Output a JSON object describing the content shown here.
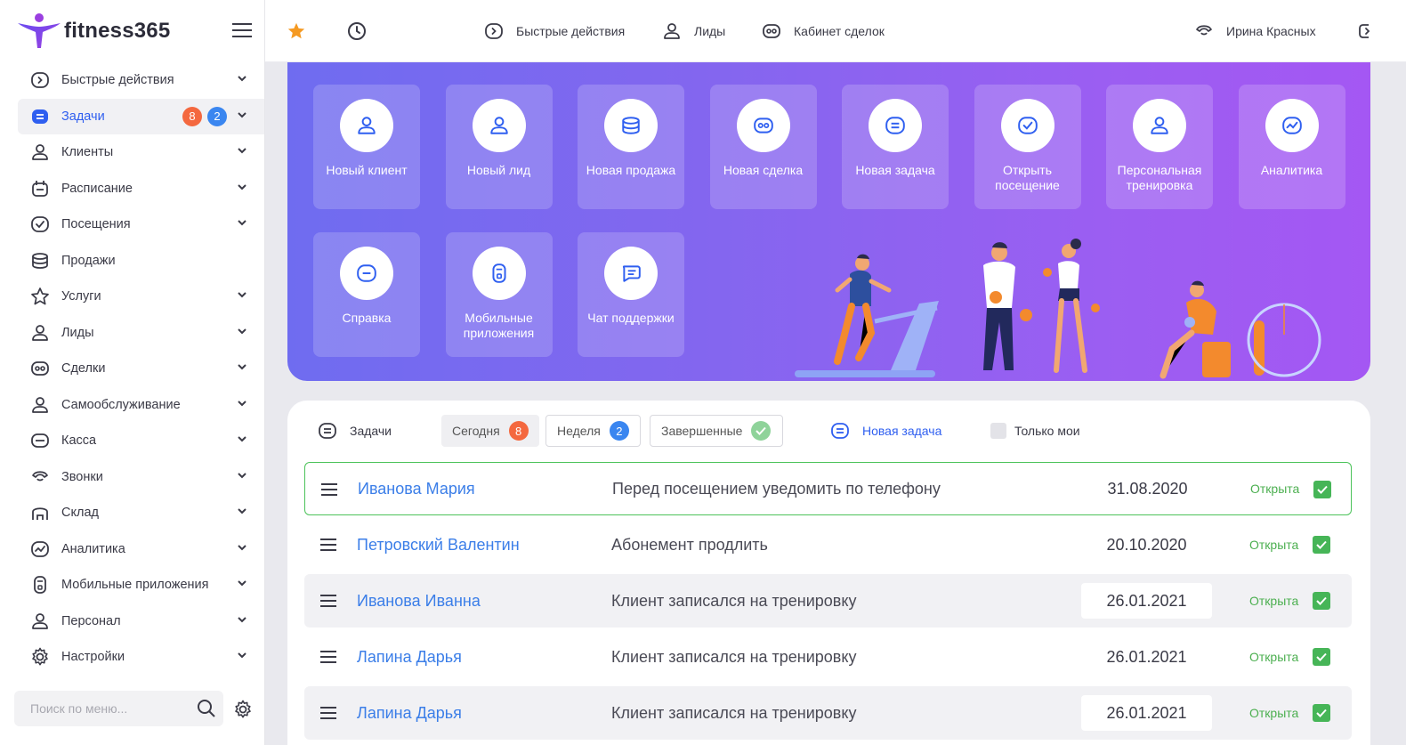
{
  "app": {
    "name": "fitness365"
  },
  "sidebar": {
    "items": [
      {
        "label": "Быстрые действия",
        "icon": "quick-actions-icon",
        "chevron": true
      },
      {
        "label": "Задачи",
        "icon": "tasks-icon",
        "chevron": true,
        "active": true,
        "badges": [
          "8",
          "2"
        ]
      },
      {
        "label": "Клиенты",
        "icon": "user-icon",
        "chevron": true
      },
      {
        "label": "Расписание",
        "icon": "calendar-icon",
        "chevron": true
      },
      {
        "label": "Посещения",
        "icon": "check-circle-icon",
        "chevron": true
      },
      {
        "label": "Продажи",
        "icon": "coins-icon",
        "chevron": false
      },
      {
        "label": "Услуги",
        "icon": "star-icon",
        "chevron": true
      },
      {
        "label": "Лиды",
        "icon": "user-icon",
        "chevron": true
      },
      {
        "label": "Сделки",
        "icon": "deals-icon",
        "chevron": true
      },
      {
        "label": "Самообслуживание",
        "icon": "user-icon",
        "chevron": true
      },
      {
        "label": "Касса",
        "icon": "cash-icon",
        "chevron": true
      },
      {
        "label": "Звонки",
        "icon": "phone-icon",
        "chevron": true
      },
      {
        "label": "Склад",
        "icon": "warehouse-icon",
        "chevron": true
      },
      {
        "label": "Аналитика",
        "icon": "analytics-icon",
        "chevron": true
      },
      {
        "label": "Мобильные приложения",
        "icon": "mobile-icon",
        "chevron": true
      },
      {
        "label": "Персонал",
        "icon": "user-icon",
        "chevron": true
      },
      {
        "label": "Настройки",
        "icon": "settings-icon",
        "chevron": true
      }
    ],
    "search_placeholder": "Поиск по меню..."
  },
  "topbar": {
    "quick_actions": "Быстрые действия",
    "leads": "Лиды",
    "deals_cabinet": "Кабинет сделок",
    "user_name": "Ирина Красных"
  },
  "tiles": [
    {
      "label": "Новый клиент",
      "icon": "user-icon"
    },
    {
      "label": "Новый лид",
      "icon": "user-icon"
    },
    {
      "label": "Новая продажа",
      "icon": "coins-icon"
    },
    {
      "label": "Новая сделка",
      "icon": "deals-icon"
    },
    {
      "label": "Новая задача",
      "icon": "tasks-icon"
    },
    {
      "label": "Открыть посещение",
      "icon": "check-circle-icon"
    },
    {
      "label": "Персональная тренировка",
      "icon": "user-icon"
    },
    {
      "label": "Аналитика",
      "icon": "analytics-icon"
    },
    {
      "label": "Справка",
      "icon": "help-icon"
    },
    {
      "label": "Мобильные приложения",
      "icon": "mobile-icon"
    },
    {
      "label": "Чат поддержки",
      "icon": "chat-icon"
    }
  ],
  "tasks": {
    "title": "Задачи",
    "tab_today": "Сегодня",
    "tab_today_count": "8",
    "tab_week": "Неделя",
    "tab_week_count": "2",
    "tab_done": "Завершенные",
    "new_task": "Новая задача",
    "only_mine": "Только мои",
    "rows": [
      {
        "name": "Иванова Мария",
        "desc": "Перед посещением уведомить по телефону",
        "date": "31.08.2020",
        "status": "Открыта"
      },
      {
        "name": "Петровский Валентин",
        "desc": "Абонемент продлить",
        "date": "20.10.2020",
        "status": "Открыта"
      },
      {
        "name": "Иванова Иванна",
        "desc": "Клиент записался на тренировку",
        "date": "26.01.2021",
        "status": "Открыта"
      },
      {
        "name": "Лапина Дарья",
        "desc": "Клиент записался на тренировку",
        "date": "26.01.2021",
        "status": "Открыта"
      },
      {
        "name": "Лапина Дарья",
        "desc": "Клиент записался на тренировку",
        "date": "26.01.2021",
        "status": "Открыта"
      }
    ]
  },
  "colors": {
    "accent": "#2f5ff0",
    "link": "#3b7ee8",
    "banner_start": "#6f6cf0",
    "banner_end": "#a457f3",
    "badge_orange": "#f4683f",
    "badge_blue": "#3a86f0",
    "success": "#46b557"
  }
}
